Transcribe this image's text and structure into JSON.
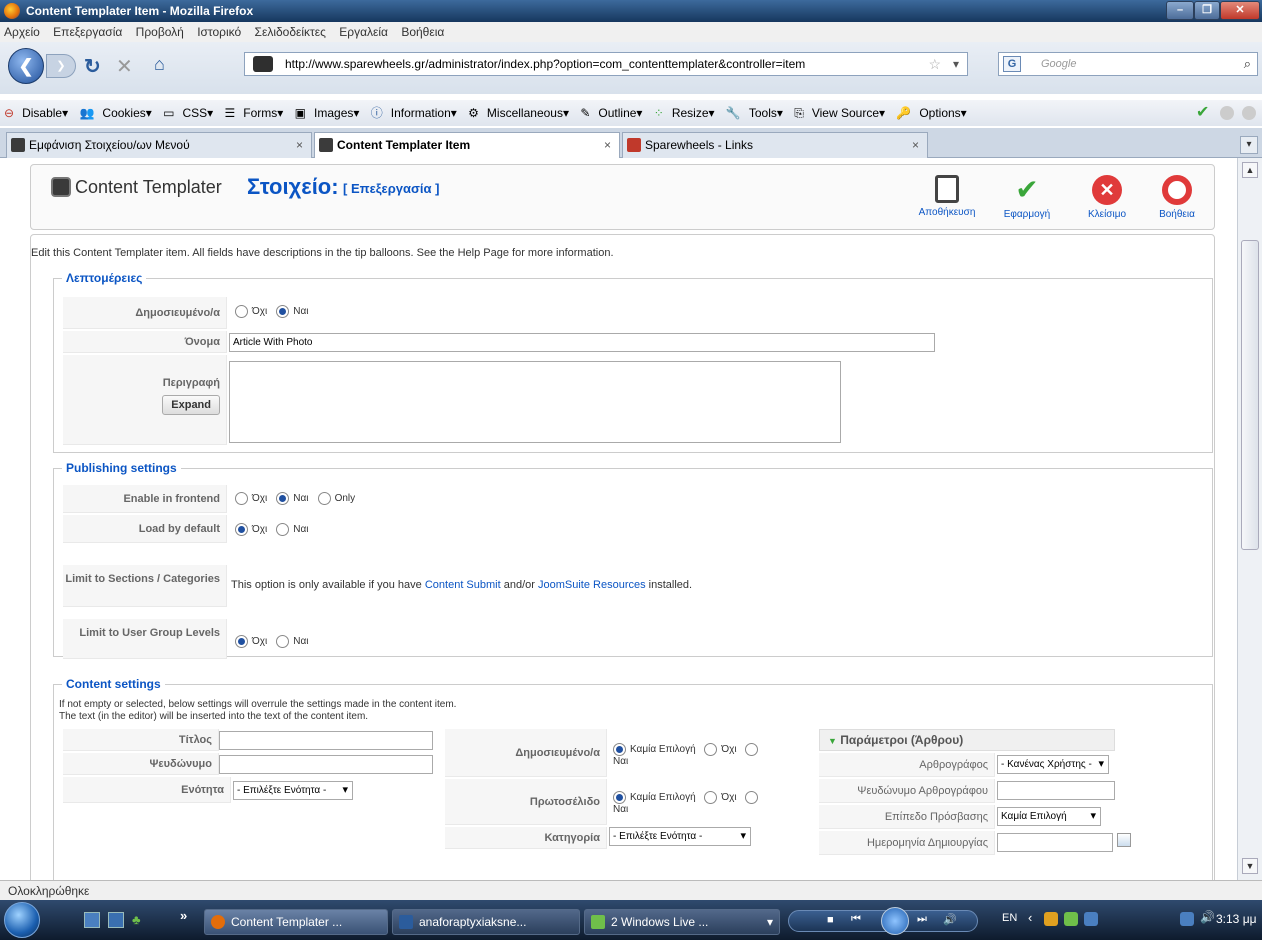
{
  "window": {
    "title": "Content Templater Item - Mozilla Firefox"
  },
  "menu": [
    "Αρχείο",
    "Επεξεργασία",
    "Προβολή",
    "Ιστορικό",
    "Σελιδοδείκτες",
    "Εργαλεία",
    "Βοήθεια"
  ],
  "nav": {
    "url": "http://www.sparewheels.gr/administrator/index.php?option=com_contenttemplater&controller=item",
    "search_placeholder": "Google"
  },
  "devbar": [
    "Disable▾",
    "Cookies▾",
    "CSS▾",
    "Forms▾",
    "Images▾",
    "Information▾",
    "Miscellaneous▾",
    "Outline▾",
    "Resize▾",
    "Tools▾",
    "View Source▾",
    "Options▾"
  ],
  "tabs": [
    {
      "label": "Εμφάνιση Στοιχείου/ων Μενού",
      "active": false
    },
    {
      "label": "Content Templater Item",
      "active": true
    },
    {
      "label": "Sparewheels - Links",
      "active": false
    }
  ],
  "header": {
    "app": "Content Templater",
    "item": "Στοιχείο:",
    "mode": "[ Επεξεργασία ]"
  },
  "toolbar": [
    {
      "label": "Αποθήκευση",
      "icon": "save-icon",
      "color": "#444444"
    },
    {
      "label": "Εφαρμογή",
      "icon": "apply-check-icon",
      "color": "#3aa63a"
    },
    {
      "label": "Κλείσιμο",
      "icon": "close-circle-icon",
      "color": "#e03a3a"
    },
    {
      "label": "Βοήθεια",
      "icon": "help-lifebuoy-icon",
      "color": "#e03a3a"
    }
  ],
  "intro": "Edit this Content Templater item. All fields have descriptions in the tip balloons. See the Help Page for more information.",
  "details": {
    "legend": "Λεπτομέρειες",
    "published_label": "Δημοσιευμένο/α",
    "opt_no": "Όχι",
    "opt_yes": "Ναι",
    "name_label": "Όνομα",
    "name_value": "Article With Photo",
    "desc_label": "Περιγραφή",
    "expand": "Expand"
  },
  "publishing": {
    "legend": "Publishing settings",
    "frontend_label": "Enable in frontend",
    "opt_no": "Όχι",
    "opt_yes": "Ναι",
    "opt_only": "Only",
    "default_label": "Load by default",
    "limit_sections_label": "Limit to Sections / Categories",
    "limit_text_pre": "This option is only available if you have",
    "link1": "Content Submit",
    "limit_text_mid": "and/or",
    "link2": "JoomSuite Resources",
    "limit_text_post": "installed.",
    "usergroup_label": "Limit to User Group Levels"
  },
  "content": {
    "legend": "Content settings",
    "note1": "If not empty or selected, below settings will overrule the settings made in the content item.",
    "note2": "The text (in the editor) will be inserted into the text of the content item.",
    "title_label": "Τίτλος",
    "alias_label": "Ψευδώνυμο",
    "section_label": "Ενότητα",
    "section_value": "- Επιλέξτε Ενότητα -",
    "published_label": "Δημοσιευμένο/α",
    "frontpage_label": "Πρωτοσέλιδο",
    "opt_none": "Καμία Επιλογή",
    "opt_no": "Όχι",
    "opt_yes": "Ναι",
    "category_label": "Κατηγορία",
    "category_value": "- Επιλέξτε Ενότητα -",
    "params_title": "Παράμετροι (Άρθρου)",
    "author_label": "Αρθρογράφος",
    "author_value": "- Κανένας Χρήστης -",
    "author_alias_label": "Ψευδώνυμο Αρθρογράφου",
    "access_label": "Επίπεδο Πρόσβασης",
    "access_value": "Καμία Επιλογή",
    "created_label": "Ημερομηνία Δημιουργίας"
  },
  "status": "Ολοκληρώθηκε",
  "taskbar": {
    "items": [
      "Content Templater ...",
      "anaforaptyxiaksne...",
      "2 Windows Live ..."
    ],
    "lang": "EN",
    "time": "3:13 μμ"
  }
}
